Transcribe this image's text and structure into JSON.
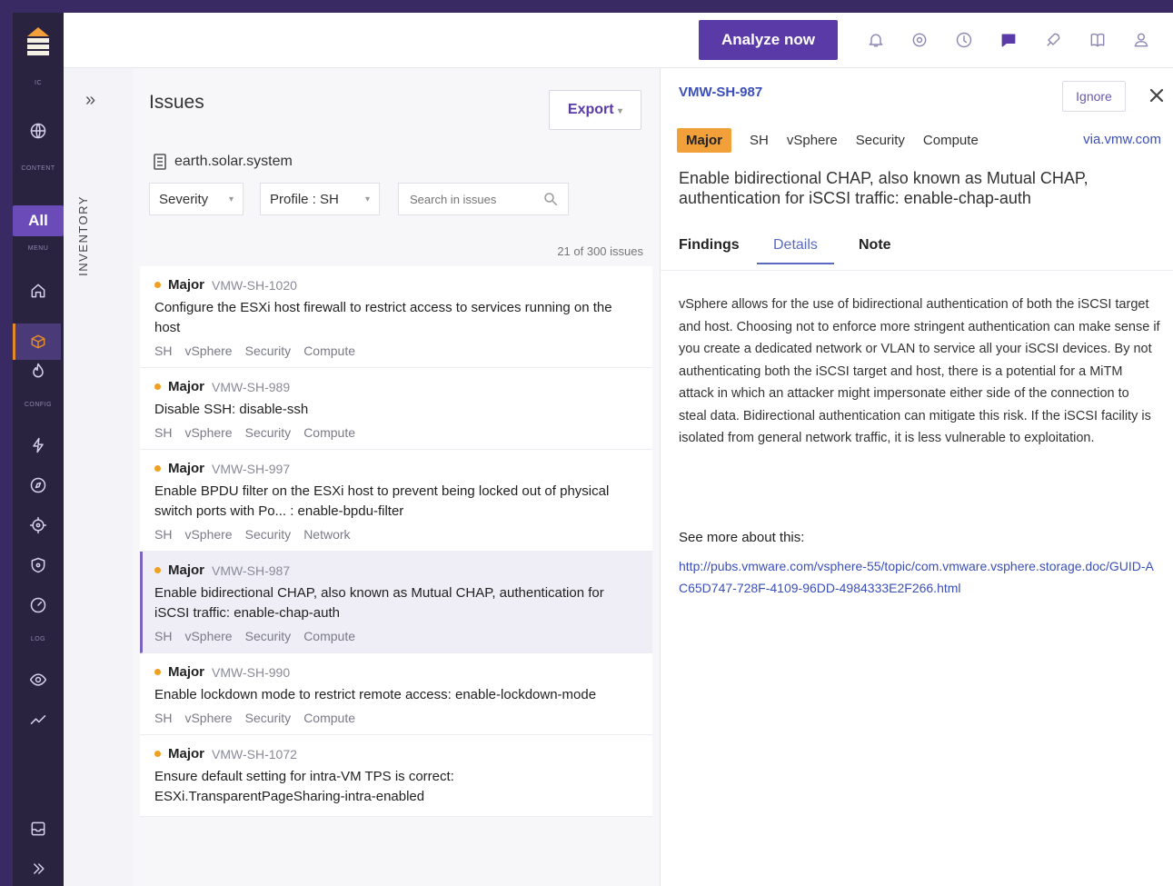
{
  "nav": {
    "labels": {
      "top": "IC",
      "content": "CONTENT",
      "menu": "MENU",
      "config": "CONFIG",
      "log": "LOG"
    },
    "all_label": "All",
    "icons": [
      "globe-icon",
      "home-icon",
      "box-icon",
      "fire-icon",
      "bolt-icon",
      "compass-icon",
      "target-icon",
      "shield-icon",
      "gauge-icon",
      "eye-icon",
      "trend-icon",
      "inbox-icon",
      "chevron-right-icon"
    ]
  },
  "topbar": {
    "analyze_label": "Analyze now",
    "icons": [
      "bell-icon",
      "gear-icon",
      "help-icon",
      "chat-icon",
      "rocket-icon",
      "book-icon",
      "user-icon"
    ]
  },
  "inventory": {
    "label": "INVENTORY",
    "expand": "»"
  },
  "issues": {
    "title": "Issues",
    "export_label": "Export",
    "system": "earth.solar.system",
    "filters": {
      "severity": "Severity",
      "profile": "Profile : SH"
    },
    "search_placeholder": "Search in issues",
    "count": "21 of 300 issues",
    "items": [
      {
        "severity": "Major",
        "id": "VMW-SH-1020",
        "title": "Configure the ESXi host firewall to restrict access to services running on the host",
        "tags": [
          "SH",
          "vSphere",
          "Security",
          "Compute"
        ]
      },
      {
        "severity": "Major",
        "id": "VMW-SH-989",
        "title": "Disable SSH: disable-ssh",
        "tags": [
          "SH",
          "vSphere",
          "Security",
          "Compute"
        ]
      },
      {
        "severity": "Major",
        "id": "VMW-SH-997",
        "title": "Enable BPDU filter on the ESXi host to prevent being locked out of physical switch ports with Po... : enable-bpdu-filter",
        "tags": [
          "SH",
          "vSphere",
          "Security",
          "Network"
        ]
      },
      {
        "severity": "Major",
        "id": "VMW-SH-987",
        "title": "Enable bidirectional CHAP, also known as Mutual CHAP, authentication for iSCSI traffic: enable-chap-auth",
        "tags": [
          "SH",
          "vSphere",
          "Security",
          "Compute"
        ]
      },
      {
        "severity": "Major",
        "id": "VMW-SH-990",
        "title": "Enable lockdown mode to restrict remote access: enable-lockdown-mode",
        "tags": [
          "SH",
          "vSphere",
          "Security",
          "Compute"
        ]
      },
      {
        "severity": "Major",
        "id": "VMW-SH-1072",
        "title": "Ensure default setting for intra-VM TPS is correct: ESXi.TransparentPageSharing-intra-enabled",
        "tags": []
      }
    ]
  },
  "detail": {
    "id": "VMW-SH-987",
    "ignore_label": "Ignore",
    "severity": "Major",
    "tags": [
      "SH",
      "vSphere",
      "Security",
      "Compute"
    ],
    "vendor_link": "via.vmw.com",
    "title": "Enable bidirectional CHAP, also known as Mutual CHAP, authentication for iSCSI traffic: enable-chap-auth",
    "tabs": [
      "Findings",
      "Details",
      "Note"
    ],
    "body": "vSphere allows for the use of bidirectional authentication of both the iSCSI target and host. Choosing not to enforce more stringent authentication can make sense if you create a dedicated network or VLAN to service all your iSCSI devices. By not authenticating both the iSCSI target and host, there is a potential for a MiTM attack in which an attacker might impersonate either side of the connection to steal data. Bidirectional authentication can mitigate this risk. If the iSCSI facility is isolated from general network traffic, it is less vulnerable to exploitation.",
    "see_more": "See more about this:",
    "url": "http://pubs.vmware.com/vsphere-55/topic/com.vmware.vsphere.storage.doc/GUID-AC65D747-728F-4109-96DD-4984333E2F266.html"
  }
}
